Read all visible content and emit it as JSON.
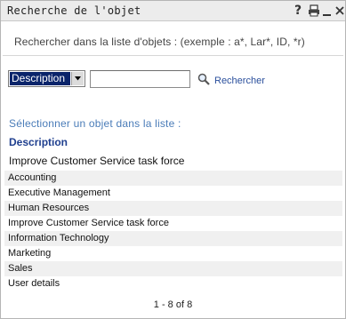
{
  "window": {
    "title": "Recherche de l'objet",
    "help_label": "?"
  },
  "search": {
    "instructions": "Rechercher dans la liste d'objets : (exemple : a*, Lar*, ID, *r)",
    "field_selected": "Description",
    "input_value": "",
    "button_label": "Rechercher"
  },
  "results": {
    "prompt": "Sélectionner un objet dans la liste :",
    "column_header": "Description",
    "current_selection": "Improve Customer Service task force",
    "items": [
      "Accounting",
      "Executive Management",
      "Human Resources",
      "Improve Customer Service task force",
      "Information Technology",
      "Marketing",
      "Sales",
      "User details"
    ],
    "pagination": "1 - 8 of 8"
  },
  "colors": {
    "link": "#2a4f9c",
    "prompt": "#4a7cb8",
    "header": "#1f3f8f",
    "selection_bg": "#0a246a"
  }
}
